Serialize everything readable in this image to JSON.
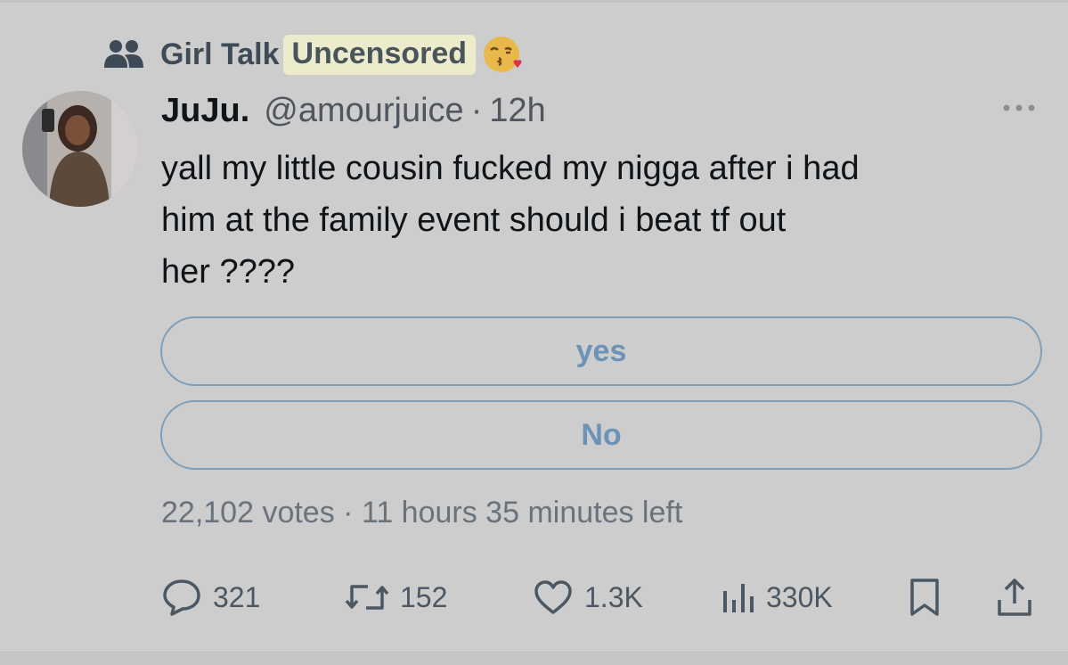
{
  "community": {
    "name": "Girl Talk",
    "highlight": "Uncensored",
    "icon": "community-people-icon",
    "emoji": "face-blowing-kiss-emoji"
  },
  "author": {
    "name": "JuJu.",
    "handle": "@amourjuice",
    "separator": "·",
    "time": "12h"
  },
  "tweet": {
    "lines": [
      "yall my little cousin fucked my nigga after i had",
      "him at the family event should i beat tf out",
      "her ????"
    ]
  },
  "poll": {
    "options": [
      {
        "label": "yes"
      },
      {
        "label": "No"
      }
    ],
    "votes": "22,102 votes",
    "separator": "·",
    "time_left": "11 hours 35 minutes left"
  },
  "actions": {
    "replies": "321",
    "reposts": "152",
    "likes": "1.3K",
    "views": "330K"
  },
  "colors": {
    "background": "#cdcdcd",
    "poll_accent": "#6a93b7",
    "highlight": "#ecebcc",
    "muted_text": "#50565d"
  }
}
